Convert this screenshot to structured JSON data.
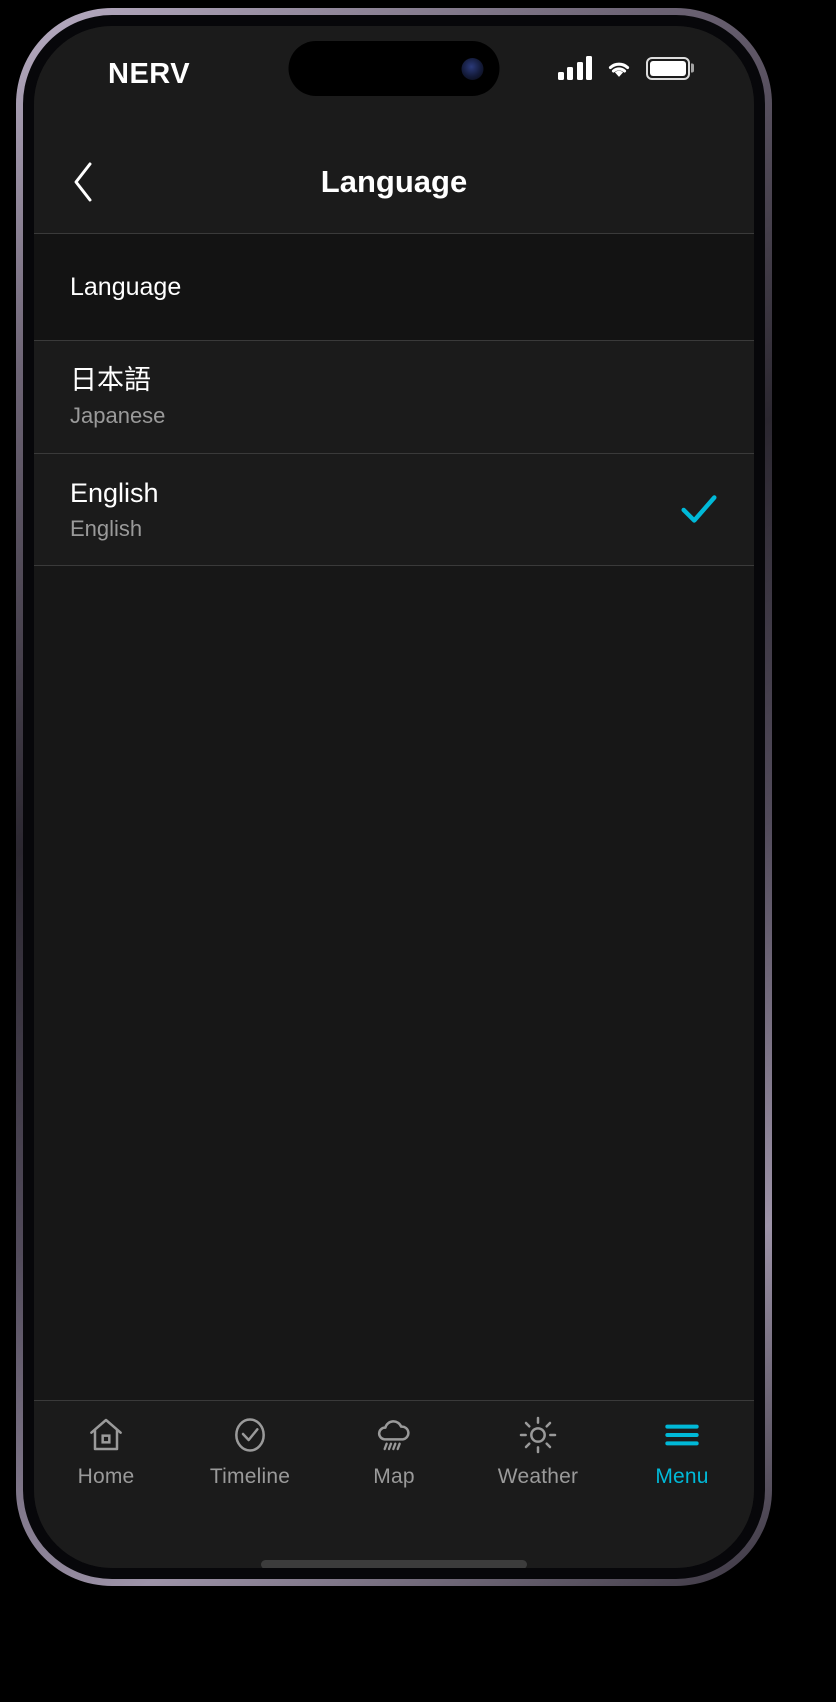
{
  "status_bar": {
    "carrier": "NERV",
    "signal_icon": "signal-bars-icon",
    "signal_bars": 4,
    "wifi_icon": "wifi-icon",
    "battery_icon": "battery-icon",
    "battery_level_percent": 100
  },
  "nav_bar": {
    "back_icon": "chevron-left-icon",
    "title": "Language"
  },
  "section": {
    "header": "Language"
  },
  "languages": [
    {
      "native": "日本語",
      "english": "Japanese",
      "selected": false
    },
    {
      "native": "English",
      "english": "English",
      "selected": true
    }
  ],
  "tabs": [
    {
      "label": "Home",
      "icon": "home-icon",
      "active": false
    },
    {
      "label": "Timeline",
      "icon": "check-circle-icon",
      "active": false
    },
    {
      "label": "Map",
      "icon": "rain-cloud-icon",
      "active": false
    },
    {
      "label": "Weather",
      "icon": "sun-icon",
      "active": false
    },
    {
      "label": "Menu",
      "icon": "hamburger-menu-icon",
      "active": true
    }
  ],
  "colors": {
    "accent": "#00b9d8",
    "screen_bg": "#171717",
    "bar_bg": "#1b1b1b",
    "section_bg": "#131313",
    "divider": "#3a3a3a",
    "text_primary": "#ffffff",
    "text_secondary": "#9a9a9a"
  }
}
